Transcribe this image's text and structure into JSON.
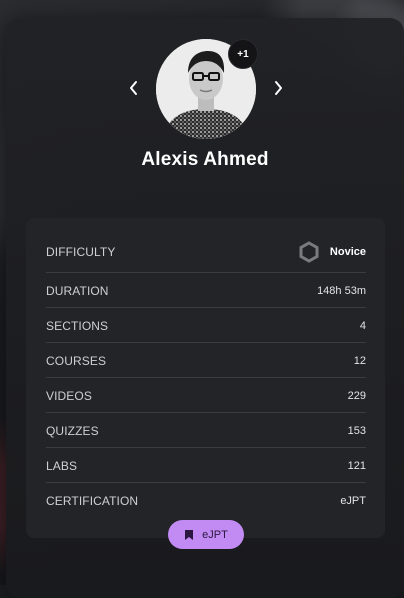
{
  "profile": {
    "name": "Alexis Ahmed",
    "extra_count": "+1"
  },
  "details": {
    "rows": [
      {
        "label": "DIFFICULTY",
        "value": "Novice"
      },
      {
        "label": "DURATION",
        "value": "148h 53m"
      },
      {
        "label": "SECTIONS",
        "value": "4"
      },
      {
        "label": "COURSES",
        "value": "12"
      },
      {
        "label": "VIDEOS",
        "value": "229"
      },
      {
        "label": "QUIZZES",
        "value": "153"
      },
      {
        "label": "LABS",
        "value": "121"
      },
      {
        "label": "CERTIFICATION",
        "value": "eJPT"
      }
    ]
  },
  "certification_chip": {
    "label": "eJPT",
    "icon": "bookmark-icon",
    "color": "#c28bf3"
  },
  "icons": {
    "difficulty": "hexagon-icon",
    "prev": "chevron-left-icon",
    "next": "chevron-right-icon"
  }
}
